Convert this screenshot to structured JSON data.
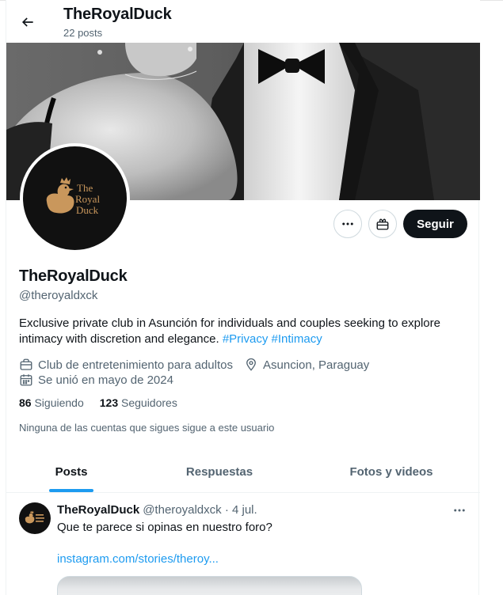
{
  "header": {
    "title": "TheRoyalDuck",
    "posts_count": "22 posts"
  },
  "profile": {
    "avatar_lines": [
      "The",
      "Royal",
      "Duck"
    ],
    "name": "TheRoyalDuck",
    "handle": "@theroyaldxck",
    "bio_text": "Exclusive private club in Asunción for individuals and couples seeking to explore intimacy with discretion and elegance. ",
    "hashtags": [
      "#Privacy",
      "#Intimacy"
    ],
    "category": "Club de entretenimiento para adultos",
    "location": "Asuncion, Paraguay",
    "joined": "Se unió en mayo de 2024",
    "following_count": "86",
    "following_label": "Siguiendo",
    "followers_count": "123",
    "followers_label": "Seguidores",
    "no_common_followers": "Ninguna de las cuentas que sigues sigue a este usuario"
  },
  "actions": {
    "follow_label": "Seguir"
  },
  "tabs": [
    {
      "label": "Posts",
      "active": true
    },
    {
      "label": "Respuestas",
      "active": false
    },
    {
      "label": "Fotos y videos",
      "active": false
    }
  ],
  "tweet": {
    "author_name": "TheRoyalDuck",
    "author_handle": "@theroyaldxck",
    "date": "· 4 jul.",
    "text": "Que te parece si opinas en nuestro foro?",
    "link_text": "instagram.com/stories/theroy..."
  },
  "colors": {
    "accent": "#1d9bf0",
    "text_primary": "#0f1419",
    "text_secondary": "#536471",
    "duck_gold": "#c9975c"
  },
  "icons": [
    "back-arrow-icon",
    "more-icon",
    "gift-icon",
    "briefcase-icon",
    "location-pin-icon",
    "calendar-icon"
  ]
}
